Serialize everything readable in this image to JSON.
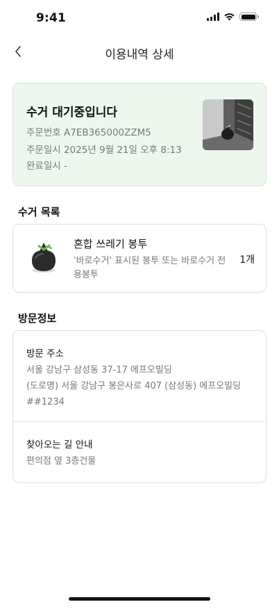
{
  "status_bar": {
    "time": "9:41"
  },
  "header": {
    "title": "이용내역 상세"
  },
  "status_card": {
    "title": "수거 대기중입니다",
    "order_number": "주문번호 A7EB365000ZZM5",
    "order_datetime": "주문일시 2025년 9월 21일 오후 8:13",
    "completed_datetime": "완료일시 -"
  },
  "pickup_list": {
    "section_title": "수거 목록",
    "items": [
      {
        "name": "혼합 쓰레기 봉투",
        "description": "'바로수거' 표시된 봉투 또는 바로수거 전용봉투",
        "quantity": "1개"
      }
    ]
  },
  "visit_info": {
    "section_title": "방문정보",
    "address_label": "방문 주소",
    "address_line1": "서울 강남구 삼성동 37-17 에프오빌딩",
    "address_line2": "(도로명) 서울 강남구 봉은사로 407 (삼성동) 에프오빌딩",
    "address_line3": "##1234",
    "directions_label": "찾아오는 길 안내",
    "directions_text": "편의점 옆 3층건물"
  },
  "icons": {
    "back": "chevron-left-icon",
    "signal": "cellular-signal-icon",
    "wifi": "wifi-icon",
    "battery": "battery-icon"
  },
  "colors": {
    "status_card_bg": "#eef7ee",
    "status_card_border": "#d5e5d7",
    "bag_tie": "#6cc04a"
  }
}
